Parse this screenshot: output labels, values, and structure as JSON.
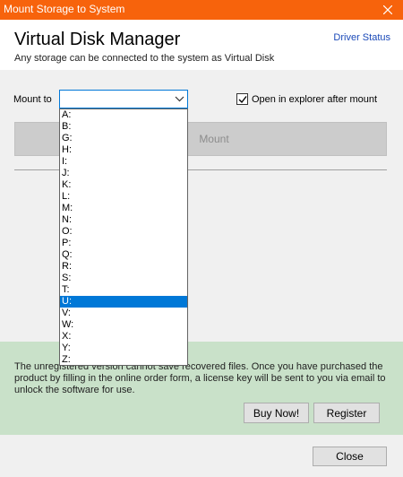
{
  "window": {
    "title": "Mount Storage to System",
    "accent_color": "#f7630c"
  },
  "header": {
    "app_title": "Virtual Disk Manager",
    "subtitle": "Any storage can be connected to the system as Virtual Disk",
    "driver_status_link": "Driver Status"
  },
  "mount": {
    "label": "Mount to",
    "selected_value": "",
    "checkbox_label": "Open in explorer after mount",
    "checkbox_checked": true,
    "mount_button": "Mount",
    "drive_options": [
      "A:",
      "B:",
      "G:",
      "H:",
      "I:",
      "J:",
      "K:",
      "L:",
      "M:",
      "N:",
      "O:",
      "P:",
      "Q:",
      "R:",
      "S:",
      "T:",
      "U:",
      "V:",
      "W:",
      "X:",
      "Y:",
      "Z:"
    ],
    "highlighted_option": "U:"
  },
  "notice": {
    "text": "The unregistered version cannot save recovered files. Once you have purchased the product by filling in the online order form, a license key will be sent to you via email to unlock the software for use.",
    "buy_button": "Buy Now!",
    "register_button": "Register",
    "background_color": "#c9e1c9"
  },
  "footer": {
    "close_button": "Close"
  }
}
